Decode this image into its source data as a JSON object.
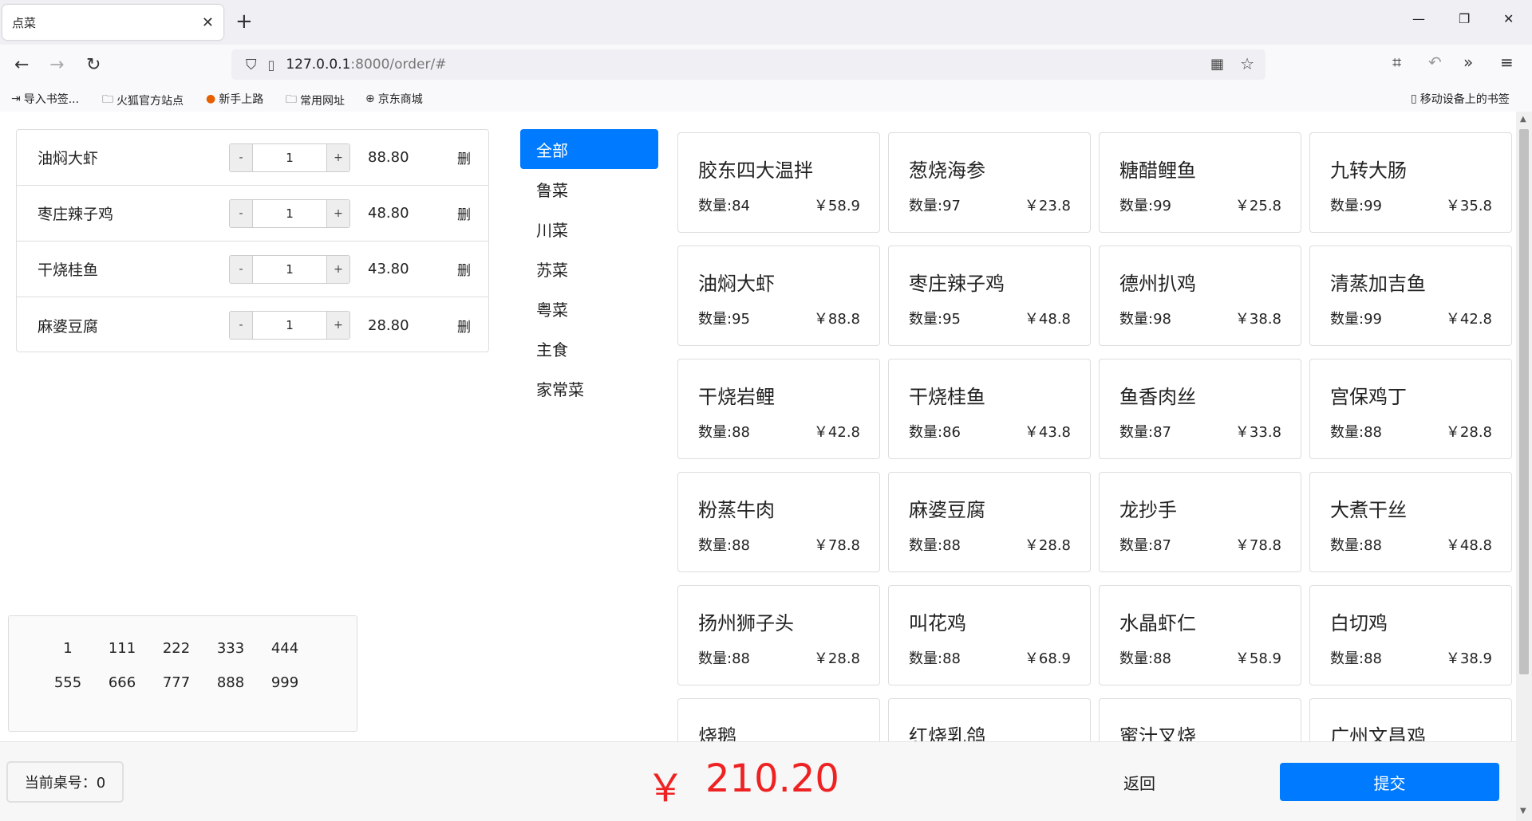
{
  "browser": {
    "tab_title": "点菜",
    "tab_close": "✕",
    "new_tab": "+",
    "url_host": "127.0.0.1",
    "url_path": ":8000/order/#",
    "bookmarks": [
      "导入书签...",
      "火狐官方站点",
      "新手上路",
      "常用网址",
      "京东商城"
    ],
    "mobile_bookmarks": "移动设备上的书签"
  },
  "orders": [
    {
      "name": "油焖大虾",
      "qty": "1",
      "price": "88.80",
      "del": "删"
    },
    {
      "name": "枣庄辣子鸡",
      "qty": "1",
      "price": "48.80",
      "del": "删"
    },
    {
      "name": "干烧桂鱼",
      "qty": "1",
      "price": "43.80",
      "del": "删"
    },
    {
      "name": "麻婆豆腐",
      "qty": "1",
      "price": "28.80",
      "del": "删"
    }
  ],
  "stepper": {
    "minus": "-",
    "plus": "+"
  },
  "tables": [
    "1",
    "111",
    "222",
    "333",
    "444",
    "555",
    "666",
    "777",
    "888",
    "999"
  ],
  "categories": [
    "全部",
    "鲁菜",
    "川菜",
    "苏菜",
    "粤菜",
    "主食",
    "家常菜"
  ],
  "dishes": [
    {
      "name": "胶东四大温拌",
      "qty": "数量:84",
      "price": "￥58.9"
    },
    {
      "name": "葱烧海参",
      "qty": "数量:97",
      "price": "￥23.8"
    },
    {
      "name": "糖醋鲤鱼",
      "qty": "数量:99",
      "price": "￥25.8"
    },
    {
      "name": "九转大肠",
      "qty": "数量:99",
      "price": "￥35.8"
    },
    {
      "name": "油焖大虾",
      "qty": "数量:95",
      "price": "￥88.8"
    },
    {
      "name": "枣庄辣子鸡",
      "qty": "数量:95",
      "price": "￥48.8"
    },
    {
      "name": "德州扒鸡",
      "qty": "数量:98",
      "price": "￥38.8"
    },
    {
      "name": "清蒸加吉鱼",
      "qty": "数量:99",
      "price": "￥42.8"
    },
    {
      "name": "干烧岩鲤",
      "qty": "数量:88",
      "price": "￥42.8"
    },
    {
      "name": "干烧桂鱼",
      "qty": "数量:86",
      "price": "￥43.8"
    },
    {
      "name": "鱼香肉丝",
      "qty": "数量:87",
      "price": "￥33.8"
    },
    {
      "name": "宫保鸡丁",
      "qty": "数量:88",
      "price": "￥28.8"
    },
    {
      "name": "粉蒸牛肉",
      "qty": "数量:88",
      "price": "￥78.8"
    },
    {
      "name": "麻婆豆腐",
      "qty": "数量:88",
      "price": "￥28.8"
    },
    {
      "name": "龙抄手",
      "qty": "数量:87",
      "price": "￥78.8"
    },
    {
      "name": "大煮干丝",
      "qty": "数量:88",
      "price": "￥48.8"
    },
    {
      "name": "扬州狮子头",
      "qty": "数量:88",
      "price": "￥28.8"
    },
    {
      "name": "叫花鸡",
      "qty": "数量:88",
      "price": "￥68.9"
    },
    {
      "name": "水晶虾仁",
      "qty": "数量:88",
      "price": "￥58.9"
    },
    {
      "name": "白切鸡",
      "qty": "数量:88",
      "price": "￥38.9"
    },
    {
      "name": "烧鹅",
      "qty": "",
      "price": ""
    },
    {
      "name": "红烧乳鸽",
      "qty": "",
      "price": ""
    },
    {
      "name": "蜜汁叉烧",
      "qty": "",
      "price": ""
    },
    {
      "name": "广州文昌鸡",
      "qty": "",
      "price": ""
    }
  ],
  "footer": {
    "table_label": "当前桌号：0",
    "currency": "￥",
    "total": "210.20",
    "back": "返回",
    "submit": "提交"
  },
  "colors": {
    "accent": "#007bff",
    "total": "#ee2222"
  }
}
